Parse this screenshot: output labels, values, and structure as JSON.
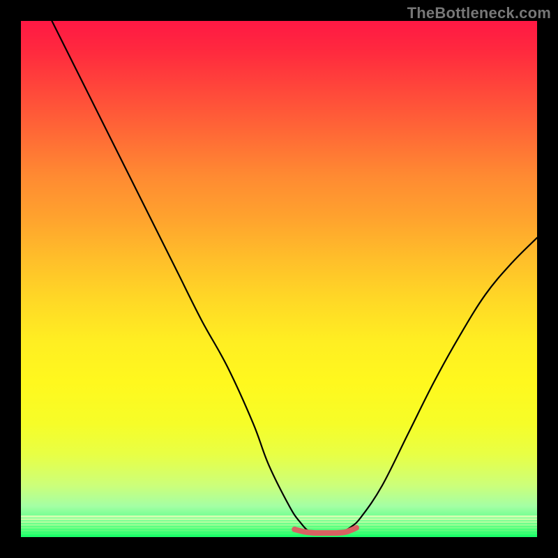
{
  "watermark": "TheBottleneck.com",
  "chart_data": {
    "type": "line",
    "title": "",
    "xlabel": "",
    "ylabel": "",
    "xlim": [
      0,
      100
    ],
    "ylim": [
      0,
      100
    ],
    "grid": false,
    "legend": false,
    "background": "red-yellow-green vertical gradient",
    "series": [
      {
        "name": "bottleneck-curve",
        "color": "#000000",
        "x": [
          6,
          10,
          15,
          20,
          25,
          30,
          35,
          40,
          45,
          48,
          52,
          54,
          56,
          58,
          60,
          62,
          64,
          66,
          70,
          75,
          80,
          85,
          90,
          95,
          100
        ],
        "y": [
          100,
          92,
          82,
          72,
          62,
          52,
          42,
          33,
          22,
          14,
          6,
          3,
          1,
          1,
          1,
          1,
          2,
          4,
          10,
          20,
          30,
          39,
          47,
          53,
          58
        ]
      },
      {
        "name": "optimal-flat-region",
        "color": "#d86262",
        "x": [
          53,
          55,
          57,
          59,
          61,
          63,
          65
        ],
        "y": [
          1.5,
          1,
          0.8,
          0.8,
          0.8,
          1,
          1.8
        ]
      }
    ],
    "annotations": []
  },
  "colors": {
    "frame": "#000000",
    "gradient_top": "#ff1844",
    "gradient_mid": "#ffee22",
    "gradient_bottom": "#1cff6a",
    "curve": "#000000",
    "flat_region": "#d86262",
    "watermark": "#777777"
  }
}
